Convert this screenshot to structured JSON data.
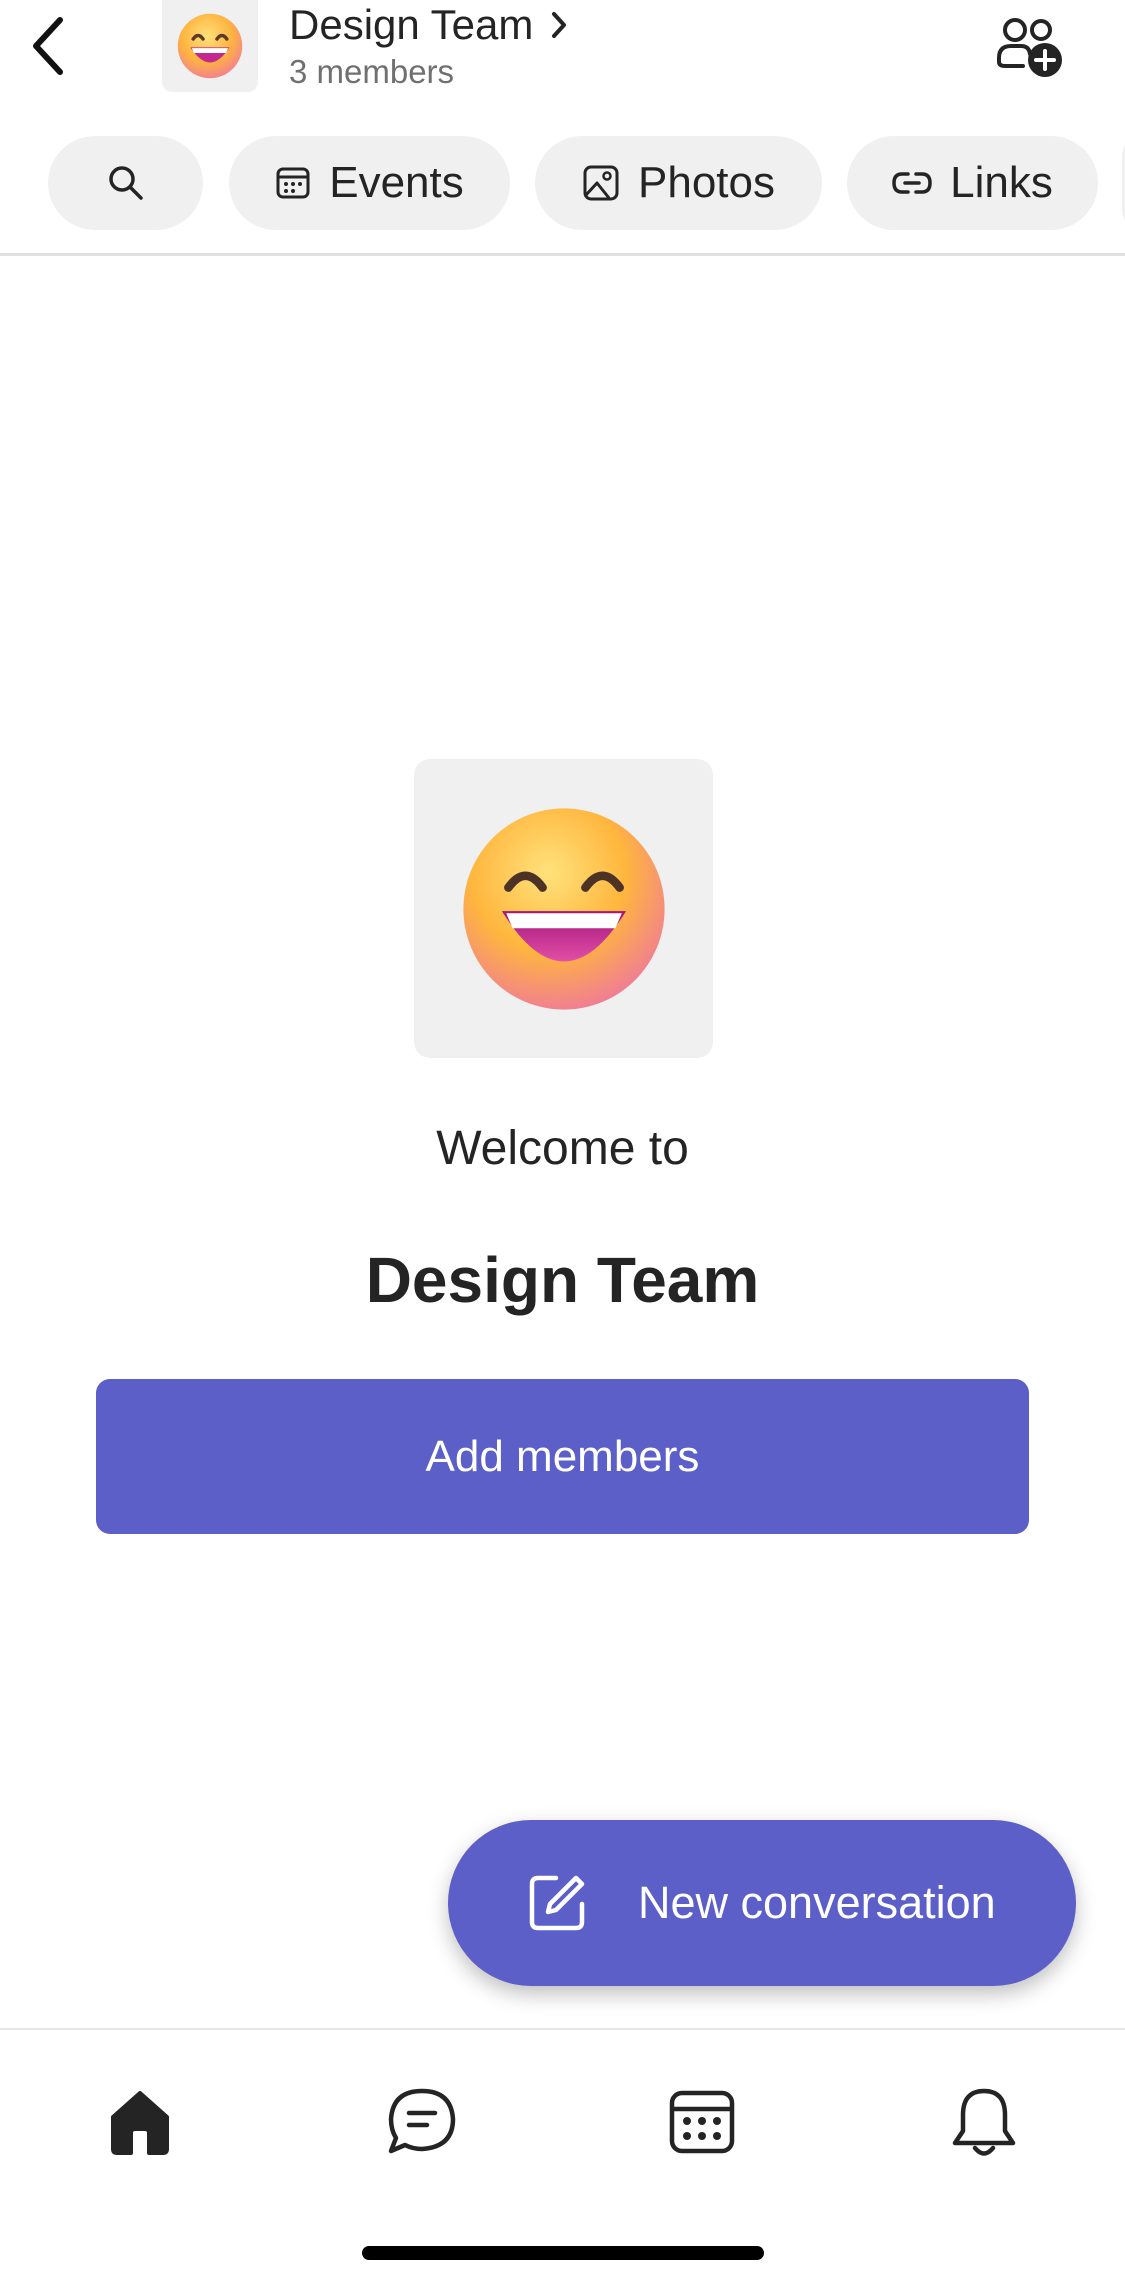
{
  "header": {
    "back_icon": "chevron-left-icon",
    "group_avatar_emoji": "😄",
    "title": "Design Team",
    "title_chevron": "›",
    "subtitle": "3 members",
    "add_people_icon": "people-add-icon"
  },
  "chips": [
    {
      "label": "",
      "icon": "search-icon"
    },
    {
      "label": "Events",
      "icon": "calendar-icon"
    },
    {
      "label": "Photos",
      "icon": "image-icon"
    },
    {
      "label": "Links",
      "icon": "link-icon"
    }
  ],
  "welcome": {
    "avatar_emoji": "😄",
    "intro": "Welcome to",
    "title": "Design Team",
    "add_members_label": "Add members"
  },
  "fab": {
    "label": "New conversation",
    "icon": "compose-icon"
  },
  "tabbar": {
    "items": [
      {
        "name": "home",
        "icon": "home-icon",
        "active": true
      },
      {
        "name": "chat",
        "icon": "chat-icon",
        "active": false
      },
      {
        "name": "calendar",
        "icon": "calendar-icon",
        "active": false
      },
      {
        "name": "activity",
        "icon": "bell-icon",
        "active": false
      }
    ]
  },
  "colors": {
    "accent": "#5b5fc7",
    "chip_bg": "#f0f0f0",
    "text": "#242424",
    "muted_text": "#707070"
  }
}
